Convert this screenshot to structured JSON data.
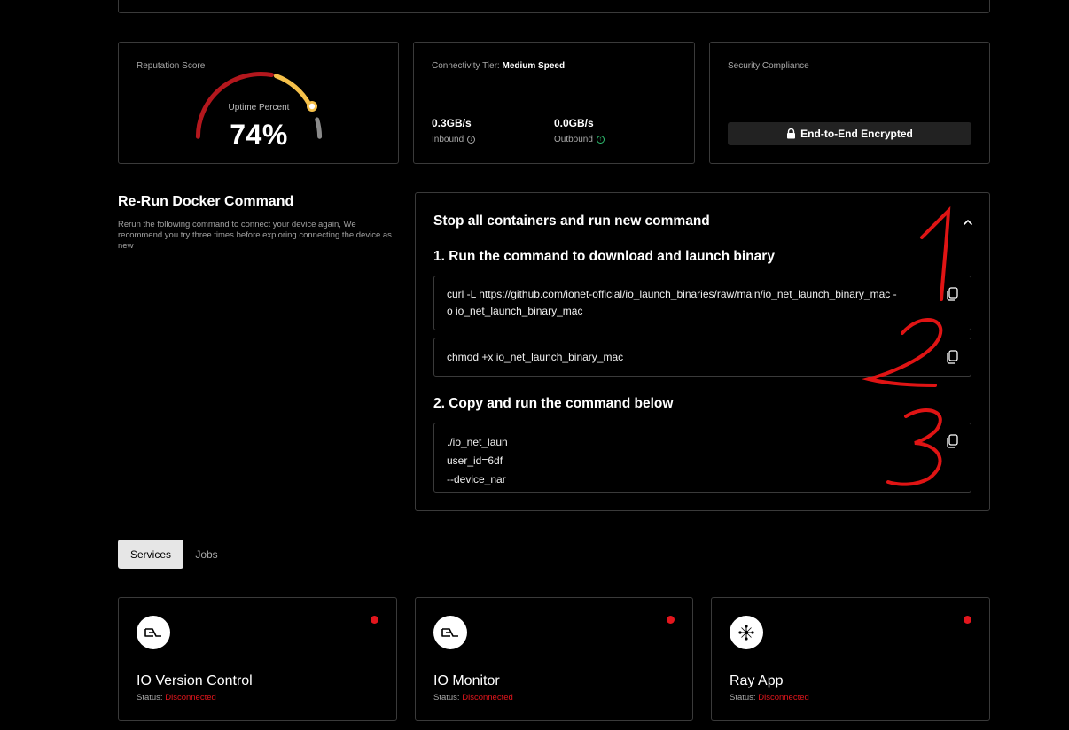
{
  "reputation": {
    "label": "Reputation Score",
    "gauge_label": "Uptime Percent",
    "value_text": "74%",
    "percent": 74
  },
  "connectivity": {
    "label": "Connectivity Tier:",
    "tier": "Medium Speed",
    "inbound_value": "0.3GB/s",
    "inbound_label": "Inbound",
    "outbound_value": "0.0GB/s",
    "outbound_label": "Outbound"
  },
  "security": {
    "label": "Security Compliance",
    "badge": "End-to-End Encrypted"
  },
  "rerun": {
    "title": "Re-Run Docker Command",
    "description": "Rerun the following command to connect your device again, We recommend you try three times before exploring connecting the device as new"
  },
  "commands": {
    "header": "Stop all containers and run new command",
    "step1_title": "1. Run the command to download and launch binary",
    "cmd1_line1": "curl -L https://github.com/ionet-official/io_launch_binaries/raw/main/io_net_launch_binary_mac -",
    "cmd1_line2": "o io_net_launch_binary_mac",
    "cmd2": "chmod +x io_net_launch_binary_mac",
    "step2_title": "2. Copy and run the command below",
    "cmd3_line1": "./io_net_laun",
    "cmd3_line2": "user_id=6df",
    "cmd3_line3": "--device_nar"
  },
  "tabs": [
    {
      "label": "Services",
      "active": true
    },
    {
      "label": "Jobs",
      "active": false
    }
  ],
  "services": [
    {
      "name": "IO Version Control",
      "status_label": "Status:",
      "status": "Disconnected",
      "icon": "io-logo-icon"
    },
    {
      "name": "IO Monitor",
      "status_label": "Status:",
      "status": "Disconnected",
      "icon": "io-logo-icon"
    },
    {
      "name": "Ray App",
      "status_label": "Status:",
      "status": "Disconnected",
      "icon": "ray-network-icon"
    }
  ],
  "colors": {
    "accent_red": "#e3161d",
    "gauge_red": "#b3171d",
    "gauge_yellow": "#f5c04a",
    "gauge_gray": "#8a8a8a",
    "outbound_green": "#2fbf71"
  }
}
